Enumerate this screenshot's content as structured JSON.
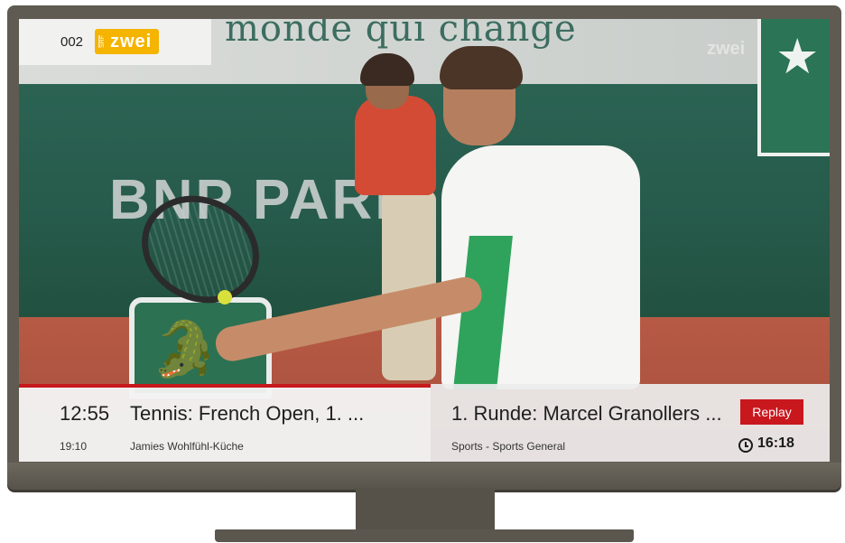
{
  "channel": {
    "number": "002",
    "logo_prefix": "SRF",
    "logo_name": "zwei"
  },
  "background": {
    "banner_text": "monde qui change",
    "wall_text": "BNP PARIB",
    "watermark": "zwei"
  },
  "now_playing": {
    "time": "12:55",
    "title": "Tennis: French Open, 1. ..."
  },
  "up_next": {
    "time": "19:10",
    "title": "Jamies Wohlfühl-Küche"
  },
  "detail": {
    "episode_title": "1. Runde: Marcel Granollers ...",
    "genre": "Sports - Sports General"
  },
  "actions": {
    "replay_label": "Replay"
  },
  "clock": {
    "icon": "clock-icon",
    "time": "16:18"
  },
  "colors": {
    "accent_red": "#c9171e",
    "channel_yellow": "#f4b400",
    "tv_frame": "#5f5b52"
  }
}
